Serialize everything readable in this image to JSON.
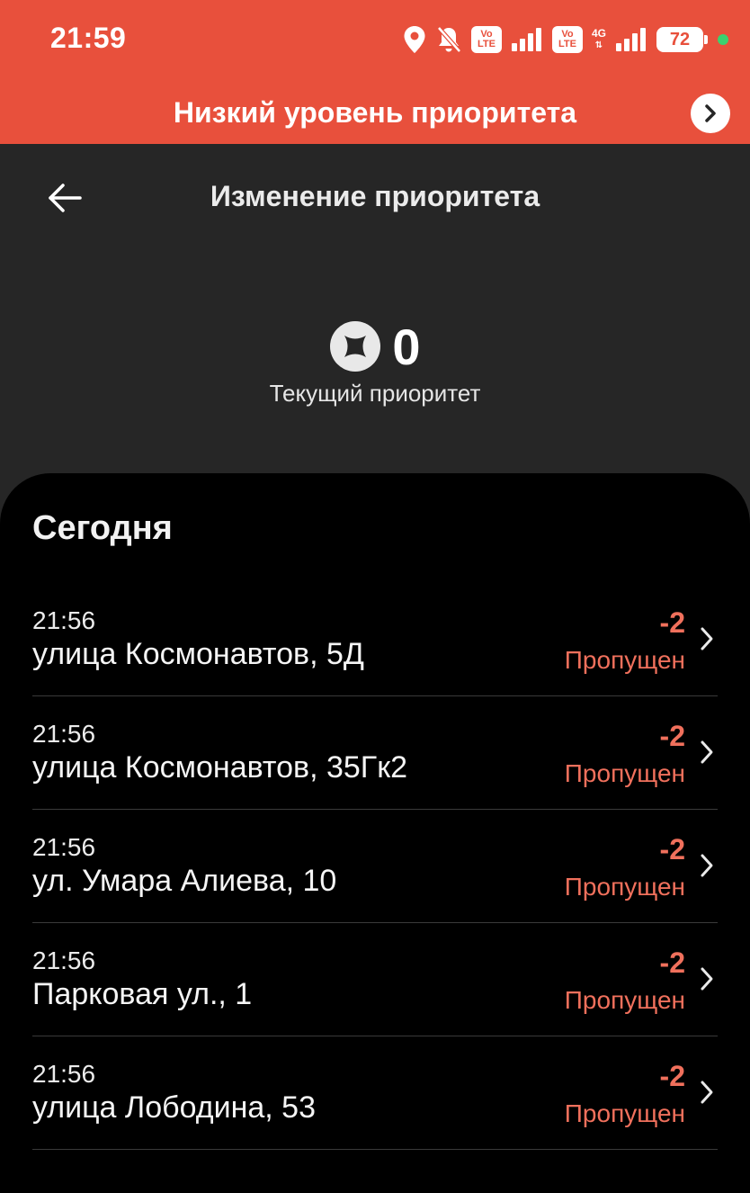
{
  "status_bar": {
    "time": "21:59",
    "volte1_top": "Vo",
    "volte1_bottom": "LTE",
    "volte2_top": "Vo",
    "volte2_bottom": "LTE",
    "network": "4G",
    "battery": "72"
  },
  "banner": {
    "text": "Низкий уровень приоритета"
  },
  "header": {
    "title": "Изменение приоритета"
  },
  "priority": {
    "value": "0",
    "label": "Текущий приоритет"
  },
  "history": {
    "section_title": "Сегодня",
    "items": [
      {
        "time": "21:56",
        "address": "улица Космонавтов, 5Д",
        "delta": "-2",
        "status": "Пропущен"
      },
      {
        "time": "21:56",
        "address": "улица Космонавтов, 35Гк2",
        "delta": "-2",
        "status": "Пропущен"
      },
      {
        "time": "21:56",
        "address": "ул. Умара Алиева, 10",
        "delta": "-2",
        "status": "Пропущен"
      },
      {
        "time": "21:56",
        "address": "Парковая ул., 1",
        "delta": "-2",
        "status": "Пропущен"
      },
      {
        "time": "21:56",
        "address": "улица Лободина, 53",
        "delta": "-2",
        "status": "Пропущен"
      }
    ]
  },
  "colors": {
    "accent": "#e8503c",
    "negative": "#f0705c",
    "background": "#262626",
    "sheet": "#000000"
  },
  "icons": {
    "location": "location-pin-icon",
    "mute": "bell-off-icon",
    "signal": "signal-bars-icon",
    "banner_arrow": "chevron-right-circle-icon",
    "back": "arrow-left-icon",
    "priority": "priority-badge-icon",
    "row_chevron": "chevron-right-icon"
  }
}
